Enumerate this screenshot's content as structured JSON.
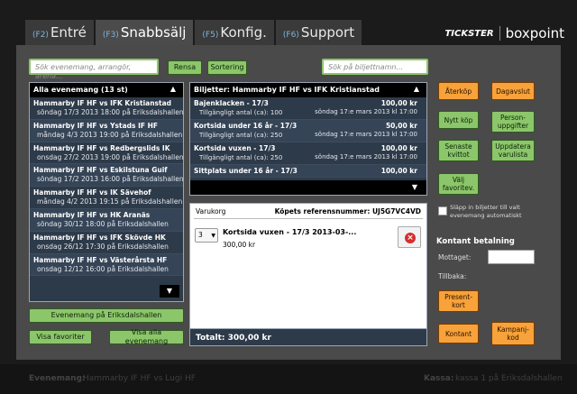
{
  "tabs": [
    {
      "key": "(F2)",
      "label": "Entré"
    },
    {
      "key": "(F3)",
      "label": "Snabbsälj"
    },
    {
      "key": "(F5)",
      "label": "Konfig."
    },
    {
      "key": "(F6)",
      "label": "Support"
    }
  ],
  "brand": {
    "tickster": "TICKSTER",
    "name": "boxpoint"
  },
  "search_events": {
    "placeholder": "Sök evenemang, arrangör, arena..."
  },
  "search_tickets": {
    "placeholder": "Sök på biljettnamn..."
  },
  "buttons": {
    "rensa": "Rensa",
    "sortering": "Sortering",
    "events_venue": "Evenemang på Eriksdalshallen",
    "show_favorites": "Visa favoriter",
    "show_all": "Visa alla evenemang"
  },
  "events": {
    "header": "Alla evenemang (13 st)",
    "items": [
      {
        "title": "Hammarby IF HF vs IFK Kristianstad",
        "info": "söndag 17/3 2013 18:00 på Eriksdalshallen"
      },
      {
        "title": "Hammarby IF HF vs Ystads IF HF",
        "info": "måndag 4/3 2013 19:00 på Eriksdalshallen"
      },
      {
        "title": "Hammarby IF HF vs Redbergslids IK",
        "info": "onsdag 27/2 2013 19:00 på Eriksdalshallen"
      },
      {
        "title": "Hammarby IF HF vs Eskilstuna Guif",
        "info": "söndag 17/2 2013 16:00 på Eriksdalshallen"
      },
      {
        "title": "Hammarby IF HF vs IK Sävehof",
        "info": "måndag 4/2 2013 19:15 på Eriksdalshallen"
      },
      {
        "title": "Hammarby IF HF vs HK Aranäs",
        "info": "söndag 30/12 18:00 på Eriksdalshallen"
      },
      {
        "title": "Hammarby IF HF vs IFK Skövde HK",
        "info": "onsdag 26/12 17:30 på Eriksdalshallen"
      },
      {
        "title": "Hammarby IF HF vs Västerårsta HF",
        "info": "onsdag 12/12 16:00 på Eriksdalshallen"
      }
    ]
  },
  "tickets": {
    "header": "Biljetter: Hammarby IF HF vs IFK Kristianstad",
    "items": [
      {
        "title": "Bajenklacken - 17/3",
        "avail": "Tillgängligt antal (ca): 100",
        "price": "100,00 kr",
        "date": "söndag 17:e mars 2013 kl 17:00"
      },
      {
        "title": "Kortsida under 16 år - 17/3",
        "avail": "Tillgängligt antal (ca): 250",
        "price": "50,00 kr",
        "date": "söndag 17:e mars 2013 kl 17:00"
      },
      {
        "title": "Kortsida vuxen - 17/3",
        "avail": "Tillgängligt antal (ca): 250",
        "price": "100,00 kr",
        "date": "söndag 17:e mars 2013 kl 17:00"
      },
      {
        "title": "Sittplats under 16 år - 17/3",
        "avail": "",
        "price": "100,00 kr",
        "date": ""
      }
    ]
  },
  "cart": {
    "label": "Varukorg",
    "ref": "Köpets referensnummer: UJ5G7VC4VD",
    "qty": "3",
    "item_title": "Kortsida vuxen - 17/3 2013-03-...",
    "item_price": "300,00 kr",
    "total": "Totalt: 300,00 kr"
  },
  "actions": {
    "aterkop": "Återköp",
    "dagavslut": "Dagavslut",
    "nytt_kop": "Nytt köp",
    "person": "Person-\nuppgifter",
    "senaste": "Senaste\nkvittot",
    "uppdatera": "Uppdatera\nvarulista",
    "valj_fav": "Välj\nfavoritev.",
    "present": "Present-\nkort",
    "kontant": "Kontant",
    "kampanj": "Kampanj-\nkod"
  },
  "checkbox_label": "Släpp in biljetter till valt evenemang automatiskt",
  "payment": {
    "title": "Kontant betalning",
    "received": "Mottaget:",
    "change": "Tillbaka:"
  },
  "footer": {
    "event_label": "Evenemang:",
    "event_value": "Hammarby IF HF vs Lugi HF",
    "kassa_label": "Kassa:",
    "kassa_value": "kassa 1 på Eriksdalshallen"
  },
  "colors": {
    "green": "#8cc66a",
    "orange": "#f7a23a",
    "panel": "#2d3a49",
    "background": "#4a4a4a"
  }
}
